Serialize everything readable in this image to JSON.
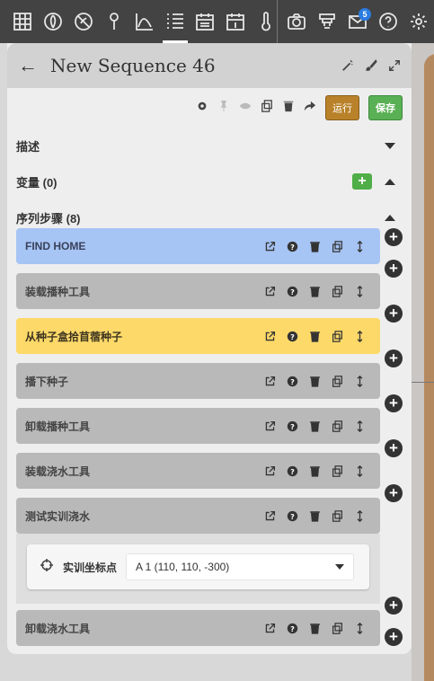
{
  "nav": {
    "items": [
      {
        "name": "nav-plants-grid",
        "icon": "grid-icon"
      },
      {
        "name": "nav-plants",
        "icon": "leaf-icon"
      },
      {
        "name": "nav-weeds",
        "icon": "no-weed-icon"
      },
      {
        "name": "nav-points",
        "icon": "map-pin-icon"
      },
      {
        "name": "nav-curves",
        "icon": "curve-icon"
      },
      {
        "name": "nav-sequences",
        "icon": "sequence-icon",
        "active": true
      },
      {
        "name": "nav-regimens",
        "icon": "calendar-grid-icon"
      },
      {
        "name": "nav-events",
        "icon": "calendar-day-icon",
        "day": "1"
      },
      {
        "name": "nav-sensors",
        "icon": "thermometer-icon"
      },
      {
        "name": "nav-photos",
        "icon": "camera-icon"
      },
      {
        "name": "nav-tools",
        "icon": "tool-icon"
      },
      {
        "name": "nav-messages",
        "icon": "envelope-icon",
        "badge": "5"
      },
      {
        "name": "nav-help",
        "icon": "question-icon"
      },
      {
        "name": "nav-settings",
        "icon": "gear-icon"
      }
    ]
  },
  "header": {
    "title": "New Sequence 46"
  },
  "toolbar": {
    "run_label": "运行",
    "save_label": "保存"
  },
  "sections": {
    "description": "描述",
    "variables": "变量 (0)",
    "steps": "序列步骤 (8)"
  },
  "steps": [
    {
      "label": "FIND HOME",
      "color": "blue"
    },
    {
      "label": "装载播种工具",
      "color": "gray"
    },
    {
      "label": "从种子盒拾苜蓿种子",
      "color": "yellow"
    },
    {
      "label": "播下种子",
      "color": "gray"
    },
    {
      "label": "卸载播种工具",
      "color": "gray"
    },
    {
      "label": "装载浇水工具",
      "color": "gray"
    },
    {
      "label": "测试实训浇水",
      "color": "gray"
    },
    {
      "label": "卸载浇水工具",
      "color": "gray"
    }
  ],
  "expanded_step": {
    "field_label": "实训坐标点",
    "field_value": "A 1 (110, 110, -300)"
  },
  "colors": {
    "blue": "#a6c4f4",
    "yellow": "#fdd969",
    "gray": "#b9b9b9",
    "run": "#b9822a",
    "save": "#5ab054"
  }
}
